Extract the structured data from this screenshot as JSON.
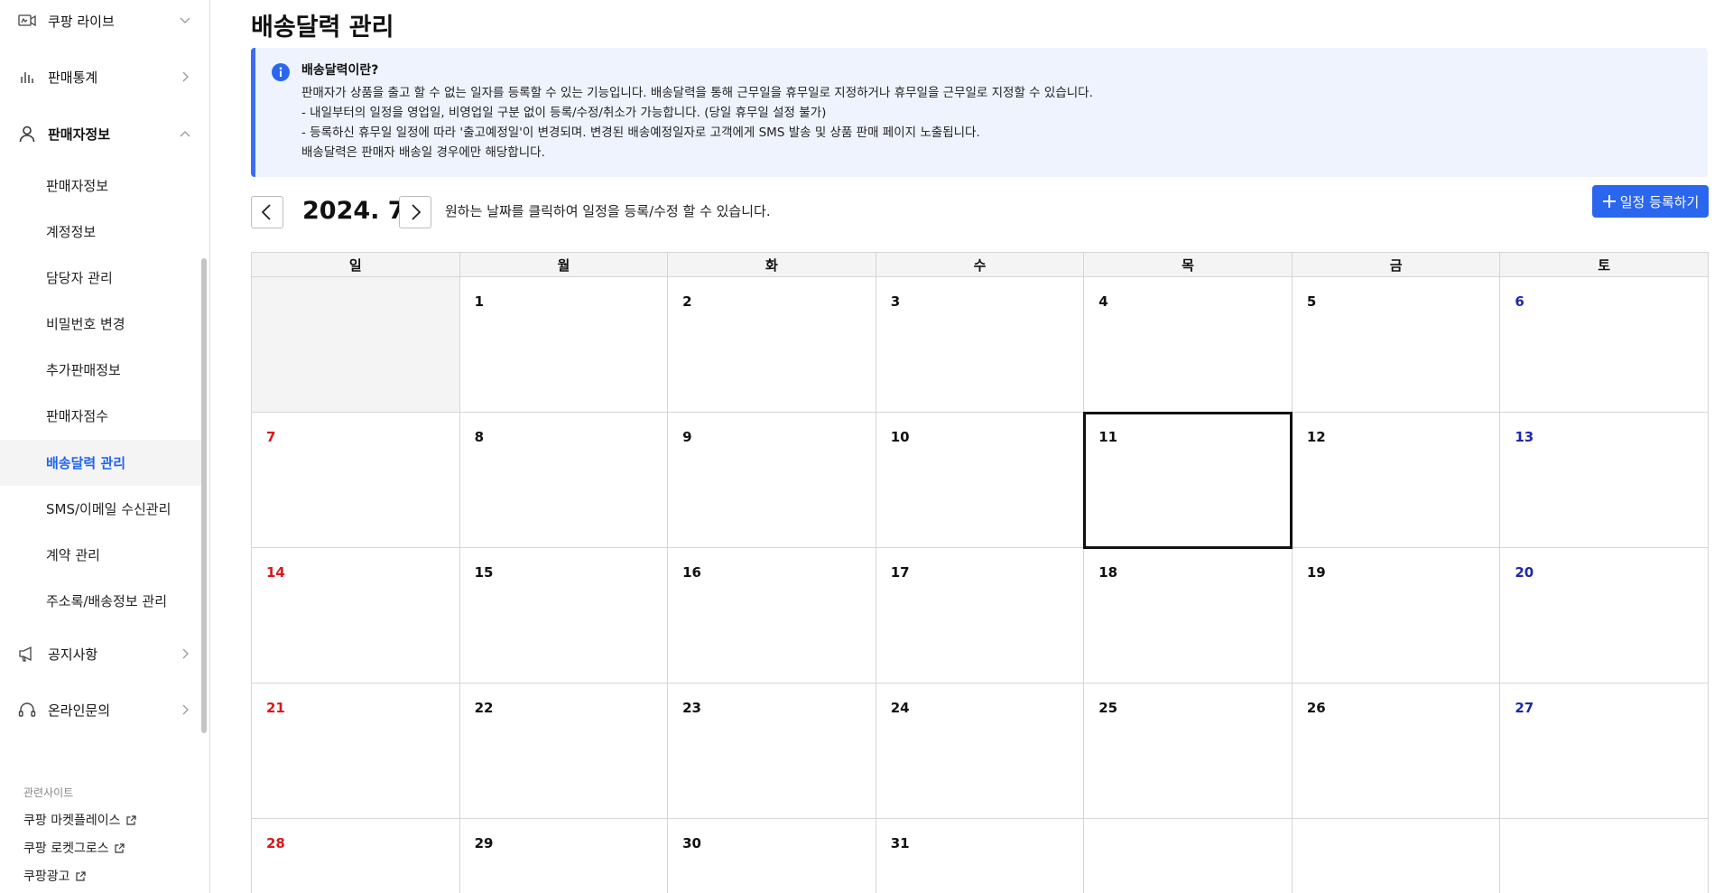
{
  "sidebar": {
    "groups": {
      "live": "쿠팡 라이브",
      "stats": "판매통계",
      "seller": "판매자정보",
      "notice": "공지사항",
      "inquiry": "온라인문의"
    },
    "items": [
      {
        "label": "판매자정보"
      },
      {
        "label": "계정정보"
      },
      {
        "label": "담당자 관리"
      },
      {
        "label": "비밀번호 변경"
      },
      {
        "label": "추가판매정보"
      },
      {
        "label": "판매자점수"
      },
      {
        "label": "배송달력 관리"
      },
      {
        "label": "SMS/이메일 수신관리"
      },
      {
        "label": "계약 관리"
      },
      {
        "label": "주소록/배송정보 관리"
      }
    ],
    "related": {
      "title": "관련사이트",
      "links": [
        "쿠팡 마켓플레이스",
        "쿠팡 로켓그로스",
        "쿠팡광고"
      ]
    }
  },
  "main": {
    "title": "배송달력 관리",
    "info": {
      "title": "배송달력이란?",
      "lines": [
        "판매자가 상품을 출고 할 수 없는 일자를 등록할 수 있는 기능입니다. 배송달력을 통해 근무일을 휴무일로 지정하거나 휴무일을 근무일로 지정할 수 있습니다.",
        "- 내일부터의 일정을 영업일, 비영업일 구분 없이 등록/수정/취소가 가능합니다. (당일 휴무일 설정 불가)",
        "- 등록하신 휴무일 일정에 따라 '출고예정일'이 변경되며. 변경된 배송예정일자로 고객에게 SMS 발송 및 상품 판매 페이지 노출됩니다.",
        "배송달력은 판매자 배송일 경우에만 해당합니다."
      ]
    },
    "month": "2024. 7",
    "hint": "원하는 날짜를 클릭하여 일정을 등록/수정 할 수 있습니다.",
    "add_button": "일정 등록하기",
    "weekdays": [
      "일",
      "월",
      "화",
      "수",
      "목",
      "금",
      "토"
    ],
    "weeks": [
      [
        "",
        "1",
        "2",
        "3",
        "4",
        "5",
        "6"
      ],
      [
        "7",
        "8",
        "9",
        "10",
        "11",
        "12",
        "13"
      ],
      [
        "14",
        "15",
        "16",
        "17",
        "18",
        "19",
        "20"
      ],
      [
        "21",
        "22",
        "23",
        "24",
        "25",
        "26",
        "27"
      ],
      [
        "28",
        "29",
        "30",
        "31",
        "",
        "",
        ""
      ]
    ],
    "selected_day": "11"
  },
  "colors": {
    "accent": "#2b66ee",
    "sunday": "#d8191b",
    "saturday": "#1d28a8",
    "info_bg": "#eef3fd"
  }
}
